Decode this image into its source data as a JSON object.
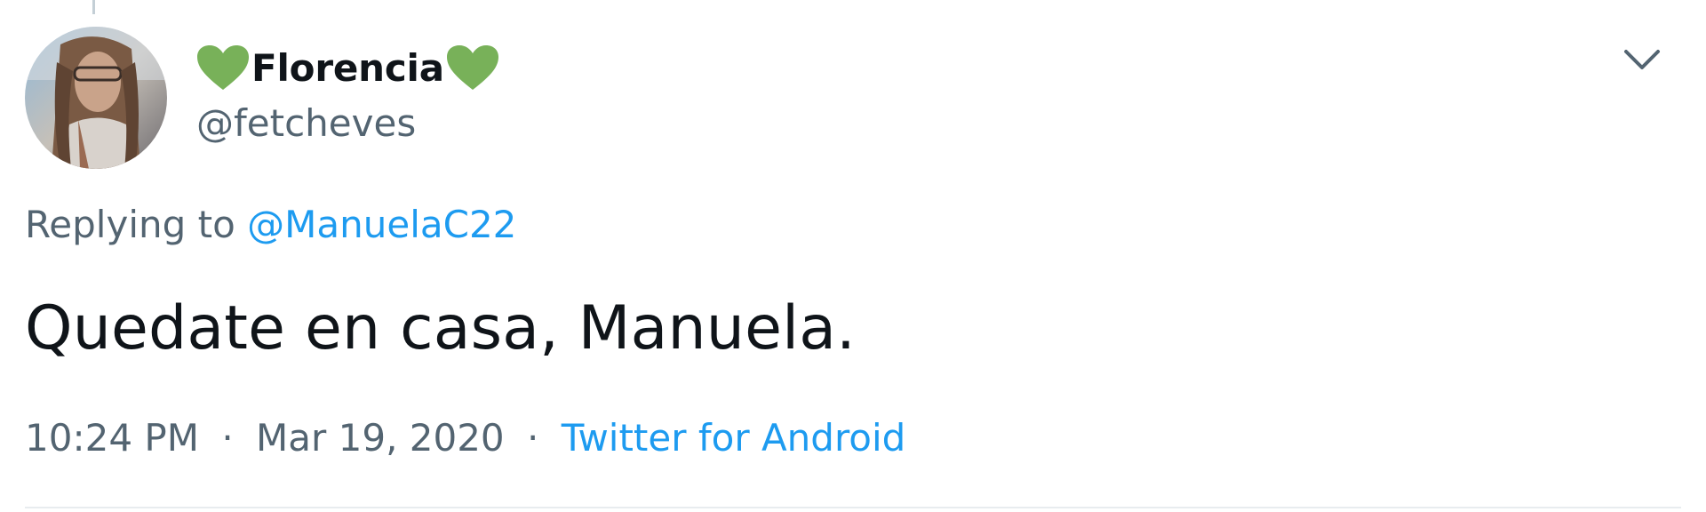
{
  "author": {
    "display_name": "Florencia",
    "name_prefix_emoji": "green-heart-icon",
    "name_suffix_emoji": "green-heart-icon",
    "handle": "@fetcheves"
  },
  "reply": {
    "prefix": "Replying to",
    "mention": "@ManuelaC22"
  },
  "tweet": {
    "text": "Quedate en casa, Manuela."
  },
  "meta": {
    "time": "10:24 PM",
    "separator": "·",
    "date": "Mar 19, 2020",
    "source": "Twitter for Android"
  },
  "colors": {
    "link": "#1d9bf0",
    "secondary_text": "#536471",
    "primary_text": "#0f1419",
    "heart": "#78b159"
  },
  "icons": {
    "menu": "chevron-down-icon"
  }
}
